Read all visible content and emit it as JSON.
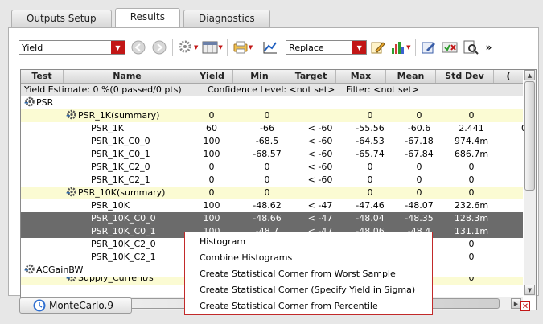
{
  "tabs": [
    "Outputs Setup",
    "Results",
    "Diagnostics"
  ],
  "toolbar": {
    "view_select": "Yield",
    "mode_select": "Replace"
  },
  "columns": [
    "Test",
    "Name",
    "Yield",
    "Min",
    "Target",
    "Max",
    "Mean",
    "Std Dev"
  ],
  "summary_line": {
    "yield_estimate": "Yield Estimate: 0 %(0 passed/0 pts)",
    "confidence": "Confidence Level: <not set>",
    "filter": "Filter: <not set>"
  },
  "tree": {
    "psr_label": "PSR",
    "acgain_label": "ACGainBW",
    "supply_label": "Supply_Current/s"
  },
  "rows": [
    {
      "name": "PSR_1K(summary)",
      "yield": "0",
      "min": "0",
      "target": "",
      "max": "0",
      "mean": "0",
      "std": "0",
      "extra": ""
    },
    {
      "name": "PSR_1K",
      "yield": "60",
      "min": "-66",
      "target": "< -60",
      "max": "-55.56",
      "mean": "-60.6",
      "std": "2.441",
      "extra": "0"
    },
    {
      "name": "PSR_1K_C0_0",
      "yield": "100",
      "min": "-68.5",
      "target": "< -60",
      "max": "-64.53",
      "mean": "-67.18",
      "std": "974.4m",
      "extra": ""
    },
    {
      "name": "PSR_1K_C0_1",
      "yield": "100",
      "min": "-68.57",
      "target": "< -60",
      "max": "-65.74",
      "mean": "-67.84",
      "std": "686.7m",
      "extra": ""
    },
    {
      "name": "PSR_1K_C2_0",
      "yield": "0",
      "min": "0",
      "target": "< -60",
      "max": "0",
      "mean": "0",
      "std": "0",
      "extra": ""
    },
    {
      "name": "PSR_1K_C2_1",
      "yield": "0",
      "min": "0",
      "target": "< -60",
      "max": "0",
      "mean": "0",
      "std": "0",
      "extra": ""
    },
    {
      "name": "PSR_10K(summary)",
      "yield": "0",
      "min": "0",
      "target": "",
      "max": "0",
      "mean": "0",
      "std": "0",
      "extra": ""
    },
    {
      "name": "PSR_10K",
      "yield": "100",
      "min": "-48.62",
      "target": "< -47",
      "max": "-47.46",
      "mean": "-48.07",
      "std": "232.6m",
      "extra": ""
    },
    {
      "name": "PSR_10K_C0_0",
      "yield": "100",
      "min": "-48.66",
      "target": "< -47",
      "max": "-48.04",
      "mean": "-48.35",
      "std": "128.3m",
      "extra": ""
    },
    {
      "name": "PSR_10K_C0_1",
      "yield": "100",
      "min": "-48.7",
      "target": "< -47",
      "max": "-48.06",
      "mean": "-48.4",
      "std": "131.1m",
      "extra": ""
    },
    {
      "name": "PSR_10K_C2_0",
      "yield": "",
      "min": "",
      "target": "",
      "max": "",
      "mean": "",
      "std": "0",
      "extra": ""
    },
    {
      "name": "PSR_10K_C2_1",
      "yield": "",
      "min": "",
      "target": "",
      "max": "",
      "mean": "",
      "std": "0",
      "extra": ""
    },
    {
      "name": "",
      "yield": "",
      "min": "",
      "target": "",
      "max": "",
      "mean": "",
      "std": "0",
      "extra": ""
    }
  ],
  "context_menu": [
    "Histogram",
    "Combine Histograms",
    "Create Statistical Corner from Worst Sample",
    "Create Statistical Corner (Specify Yield in Sigma)",
    "Create Statistical Corner from Percentile"
  ],
  "bottom_tab": "MonteCarlo.9",
  "colors": {
    "accent_red": "#c21616",
    "summary_row": "#fbfbd3",
    "selected_row": "#6b6b6b"
  }
}
